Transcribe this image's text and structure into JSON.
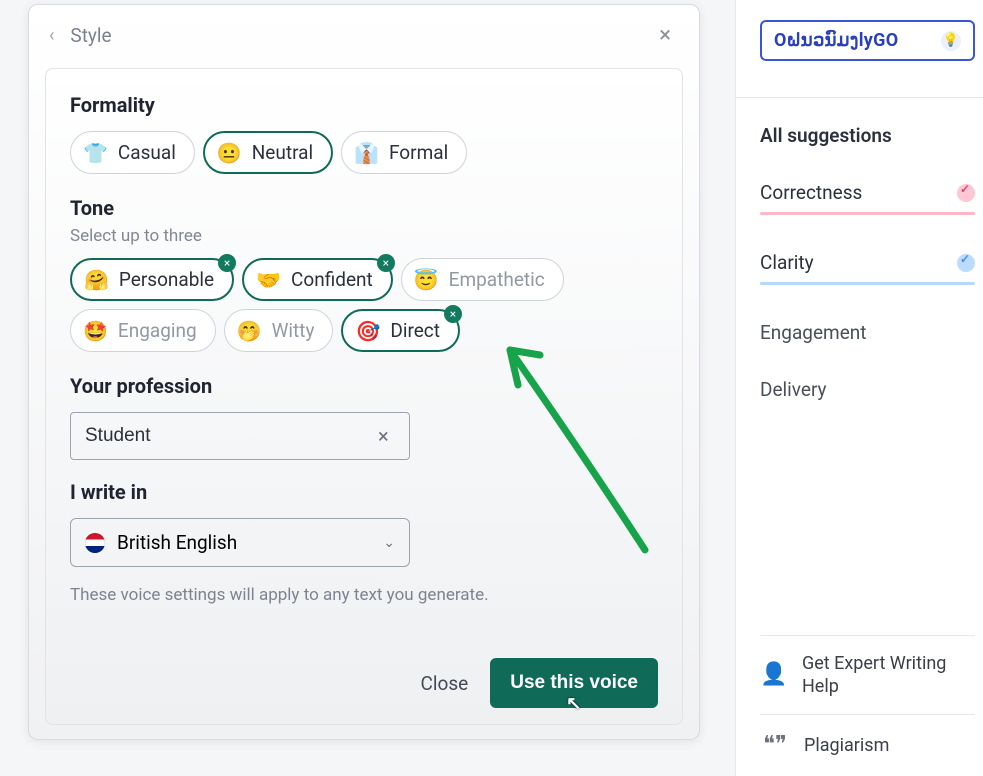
{
  "header": {
    "title": "Style"
  },
  "formality": {
    "label": "Formality",
    "options": [
      {
        "emoji": "👕",
        "text": "Casual",
        "selected": false
      },
      {
        "emoji": "😐",
        "text": "Neutral",
        "selected": true
      },
      {
        "emoji": "👔",
        "text": "Formal",
        "selected": false
      }
    ]
  },
  "tone": {
    "label": "Tone",
    "sublabel": "Select up to three",
    "options": [
      {
        "emoji": "🤗",
        "text": "Personable",
        "selected": true
      },
      {
        "emoji": "🤝",
        "text": "Confident",
        "selected": true
      },
      {
        "emoji": "😇",
        "text": "Empathetic",
        "selected": false
      },
      {
        "emoji": "🤩",
        "text": "Engaging",
        "selected": false
      },
      {
        "emoji": "🤭",
        "text": "Witty",
        "selected": false
      },
      {
        "emoji": "🎯",
        "text": "Direct",
        "selected": true
      }
    ]
  },
  "profession": {
    "label": "Your profession",
    "value": "Student"
  },
  "language": {
    "label": "I write in",
    "value": "British English"
  },
  "footnote": "These voice settings will apply to any text you generate.",
  "actions": {
    "close": "Close",
    "submit": "Use this voice"
  },
  "sidebar": {
    "brand": "OຝນວນົມງlyGO",
    "categories": {
      "all": "All suggestions",
      "correctness": "Correctness",
      "clarity": "Clarity",
      "engagement": "Engagement",
      "delivery": "Delivery"
    },
    "expert": "Get Expert Writing Help",
    "plagiarism": "Plagiarism"
  }
}
